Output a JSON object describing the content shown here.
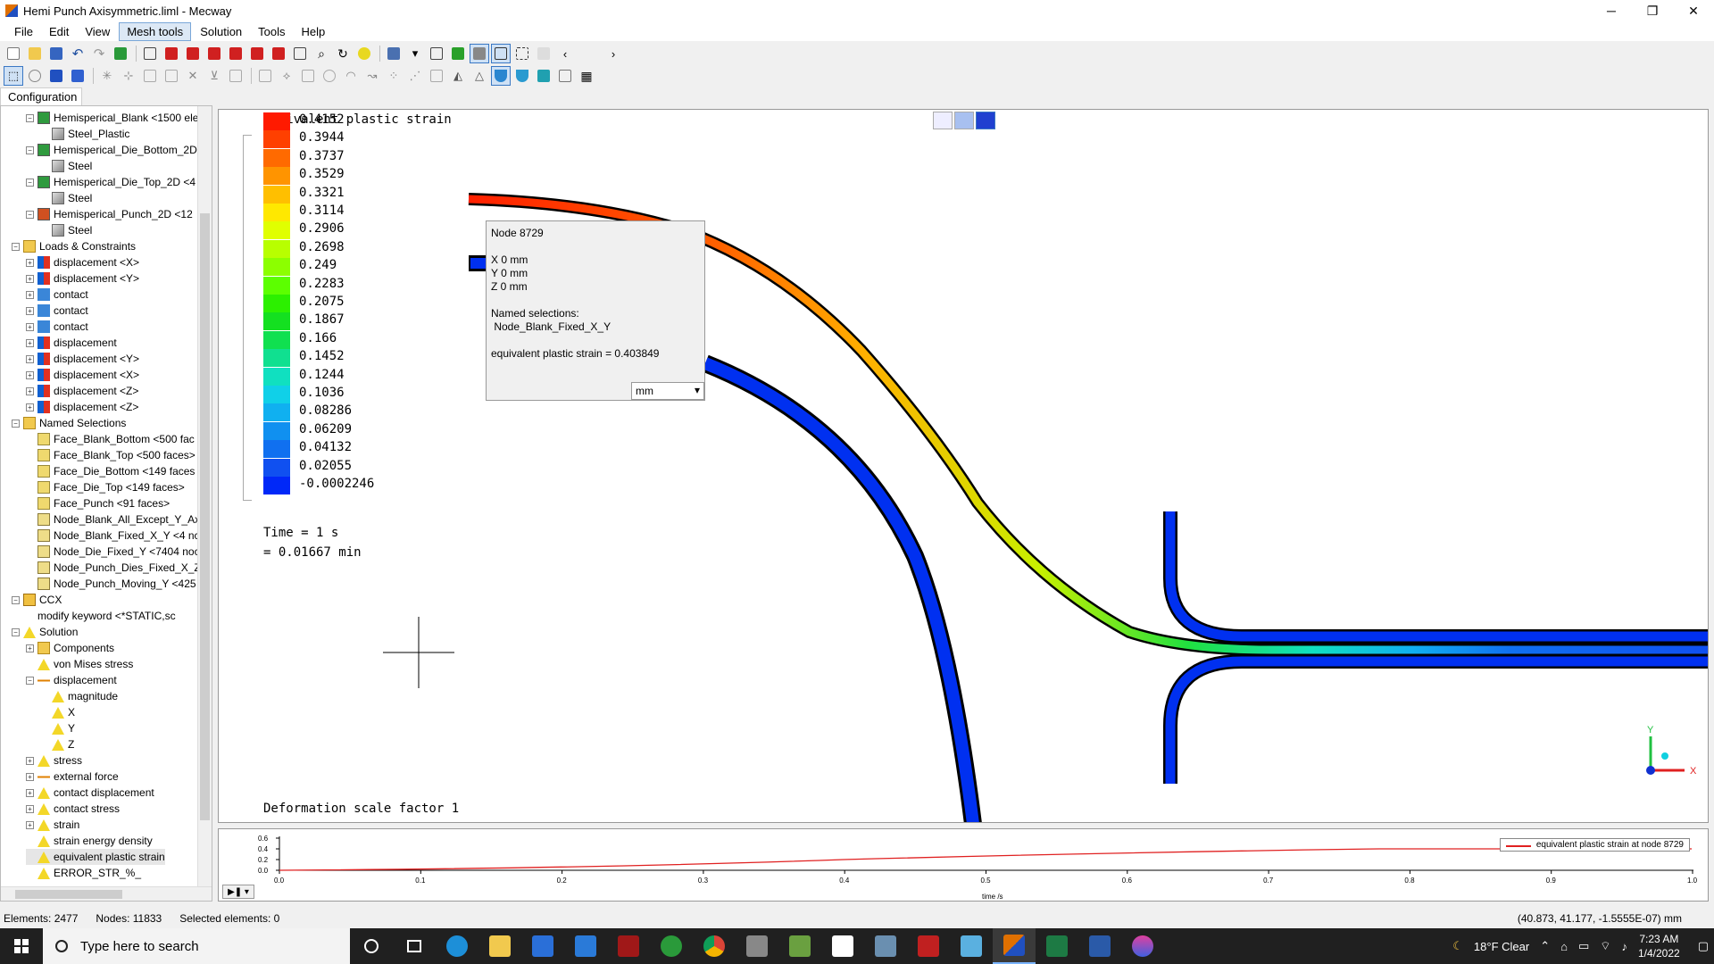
{
  "window": {
    "title": "Hemi Punch Axisymmetric.liml - Mecway"
  },
  "menu": [
    "File",
    "Edit",
    "View",
    "Mesh tools",
    "Solution",
    "Tools",
    "Help"
  ],
  "left_tab": "Configuration",
  "tree": [
    {
      "label": "Hemisperical_Blank <1500 ele",
      "level": 2,
      "icon": "ico-part",
      "exp": "−"
    },
    {
      "label": "Steel_Plastic",
      "level": 3,
      "icon": "ico-mat",
      "exp": ""
    },
    {
      "label": "Hemisperical_Die_Bottom_2D",
      "level": 2,
      "icon": "ico-part",
      "exp": "−"
    },
    {
      "label": "Steel",
      "level": 3,
      "icon": "ico-mat",
      "exp": ""
    },
    {
      "label": "Hemisperical_Die_Top_2D <4",
      "level": 2,
      "icon": "ico-part",
      "exp": "−"
    },
    {
      "label": "Steel",
      "level": 3,
      "icon": "ico-mat",
      "exp": ""
    },
    {
      "label": "Hemisperical_Punch_2D <12",
      "level": 2,
      "icon": "ico-punch",
      "exp": "−"
    },
    {
      "label": "Steel",
      "level": 3,
      "icon": "ico-mat",
      "exp": ""
    },
    {
      "label": "Loads & Constraints",
      "level": 1,
      "icon": "ico-folder",
      "exp": "−"
    },
    {
      "label": "displacement <X>",
      "level": 2,
      "icon": "ico-load",
      "exp": "+"
    },
    {
      "label": "displacement <Y>",
      "level": 2,
      "icon": "ico-load",
      "exp": "+"
    },
    {
      "label": "contact",
      "level": 2,
      "icon": "ico-contact",
      "exp": "+"
    },
    {
      "label": "contact",
      "level": 2,
      "icon": "ico-contact",
      "exp": "+"
    },
    {
      "label": "contact",
      "level": 2,
      "icon": "ico-contact",
      "exp": "+"
    },
    {
      "label": "displacement",
      "level": 2,
      "icon": "ico-load",
      "exp": "+"
    },
    {
      "label": "displacement <Y>",
      "level": 2,
      "icon": "ico-load",
      "exp": "+"
    },
    {
      "label": "displacement <X>",
      "level": 2,
      "icon": "ico-load",
      "exp": "+"
    },
    {
      "label": "displacement <Z>",
      "level": 2,
      "icon": "ico-load",
      "exp": "+"
    },
    {
      "label": "displacement <Z>",
      "level": 2,
      "icon": "ico-load",
      "exp": "+"
    },
    {
      "label": "Named Selections",
      "level": 1,
      "icon": "ico-folder",
      "exp": "−"
    },
    {
      "label": "Face_Blank_Bottom <500 fac",
      "level": 2,
      "icon": "ico-sel",
      "exp": ""
    },
    {
      "label": "Face_Blank_Top <500 faces>",
      "level": 2,
      "icon": "ico-sel",
      "exp": ""
    },
    {
      "label": "Face_Die_Bottom <149 faces",
      "level": 2,
      "icon": "ico-sel",
      "exp": ""
    },
    {
      "label": "Face_Die_Top <149 faces>",
      "level": 2,
      "icon": "ico-sel",
      "exp": ""
    },
    {
      "label": "Face_Punch <91 faces>",
      "level": 2,
      "icon": "ico-sel",
      "exp": ""
    },
    {
      "label": "Node_Blank_All_Except_Y_Ax",
      "level": 2,
      "icon": "ico-node",
      "exp": ""
    },
    {
      "label": "Node_Blank_Fixed_X_Y <4 nc",
      "level": 2,
      "icon": "ico-node",
      "exp": ""
    },
    {
      "label": "Node_Die_Fixed_Y <7404 noc",
      "level": 2,
      "icon": "ico-node",
      "exp": ""
    },
    {
      "label": "Node_Punch_Dies_Fixed_X_Z",
      "level": 2,
      "icon": "ico-node",
      "exp": ""
    },
    {
      "label": "Node_Punch_Moving_Y <425",
      "level": 2,
      "icon": "ico-node",
      "exp": ""
    },
    {
      "label": "CCX",
      "level": 1,
      "icon": "ico-ccx",
      "exp": "−"
    },
    {
      "label": "modify keyword <*STATIC,sc",
      "level": 2,
      "icon": "",
      "exp": ""
    },
    {
      "label": "Solution",
      "level": 1,
      "icon": "ico-sol",
      "exp": "−"
    },
    {
      "label": "Components",
      "level": 2,
      "icon": "ico-folder",
      "exp": "+"
    },
    {
      "label": "von Mises stress",
      "level": 2,
      "icon": "ico-sol",
      "exp": ""
    },
    {
      "label": "displacement",
      "level": 2,
      "icon": "ico-arrow",
      "exp": "−"
    },
    {
      "label": "magnitude",
      "level": 3,
      "icon": "ico-sol",
      "exp": ""
    },
    {
      "label": "X",
      "level": 3,
      "icon": "ico-sol",
      "exp": ""
    },
    {
      "label": "Y",
      "level": 3,
      "icon": "ico-sol",
      "exp": ""
    },
    {
      "label": "Z",
      "level": 3,
      "icon": "ico-sol",
      "exp": ""
    },
    {
      "label": "stress",
      "level": 2,
      "icon": "ico-sol",
      "exp": "+"
    },
    {
      "label": "external force",
      "level": 2,
      "icon": "ico-arrow",
      "exp": "+"
    },
    {
      "label": "contact displacement",
      "level": 2,
      "icon": "ico-sol",
      "exp": "+"
    },
    {
      "label": "contact stress",
      "level": 2,
      "icon": "ico-sol",
      "exp": "+"
    },
    {
      "label": "strain",
      "level": 2,
      "icon": "ico-sol",
      "exp": "+"
    },
    {
      "label": "strain energy density",
      "level": 2,
      "icon": "ico-sol",
      "exp": ""
    },
    {
      "label": "equivalent plastic strain",
      "level": 2,
      "icon": "ico-sol",
      "exp": "",
      "selected": true
    },
    {
      "label": "ERROR_STR_%_",
      "level": 2,
      "icon": "ico-sol",
      "exp": ""
    }
  ],
  "legend": {
    "title": "equivalent plastic strain",
    "values": [
      "0.4152",
      "0.3944",
      "0.3737",
      "0.3529",
      "0.3321",
      "0.3114",
      "0.2906",
      "0.2698",
      "0.249",
      "0.2283",
      "0.2075",
      "0.1867",
      "0.166",
      "0.1452",
      "0.1244",
      "0.1036",
      "0.08286",
      "0.06209",
      "0.04132",
      "0.02055",
      "-0.0002246"
    ],
    "colors": [
      "#ff1a00",
      "#ff4000",
      "#ff6a00",
      "#ff9400",
      "#ffbf00",
      "#ffe800",
      "#e0ff00",
      "#b8ff00",
      "#8cff00",
      "#5cff00",
      "#2cf000",
      "#14e020",
      "#10e050",
      "#10e090",
      "#10e0c0",
      "#10d0e8",
      "#10b0f0",
      "#1090f0",
      "#1070f0",
      "#1050f0",
      "#0028f8"
    ]
  },
  "time": {
    "line1": "Time = 1 s",
    "line2": "= 0.01667 min"
  },
  "deformation": "Deformation scale factor 1",
  "popup": {
    "node": "Node  8729",
    "x": "X  0 mm",
    "y": "Y  0 mm",
    "z": "Z  0 mm",
    "named_label": "Named selections:",
    "named_value": " Node_Blank_Fixed_X_Y",
    "result": "equivalent plastic strain = 0.403849",
    "unit": "mm"
  },
  "graph": {
    "legend": "equivalent plastic strain at node 8729",
    "xlabel": "time /s",
    "yticks": [
      "0.6",
      "0.4",
      "0.2",
      "0.0"
    ],
    "xticks": [
      "0.0",
      "0.1",
      "0.2",
      "0.3",
      "0.4",
      "0.5",
      "0.6",
      "0.7",
      "0.8",
      "0.9",
      "1.0"
    ]
  },
  "status": {
    "elements": "Elements: 2477",
    "nodes": "Nodes: 11833",
    "selected": "Selected elements: 0",
    "coord": "(40.873, 41.177, -1.5555E-07) mm"
  },
  "taskbar": {
    "search_placeholder": "Type here to search",
    "weather": "18°F  Clear",
    "time": "7:23 AM",
    "date": "1/4/2022"
  },
  "axes": {
    "x": "X",
    "y": "Y"
  }
}
